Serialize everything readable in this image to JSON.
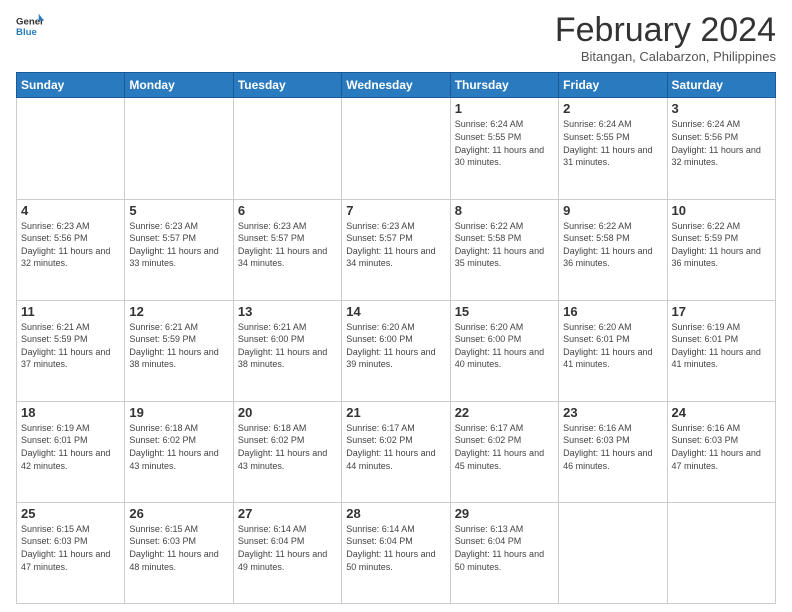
{
  "header": {
    "logo": {
      "general": "General",
      "blue": "Blue"
    },
    "title": "February 2024",
    "location": "Bitangan, Calabarzon, Philippines"
  },
  "weekdays": [
    "Sunday",
    "Monday",
    "Tuesday",
    "Wednesday",
    "Thursday",
    "Friday",
    "Saturday"
  ],
  "weeks": [
    [
      {
        "day": "",
        "info": ""
      },
      {
        "day": "",
        "info": ""
      },
      {
        "day": "",
        "info": ""
      },
      {
        "day": "",
        "info": ""
      },
      {
        "day": "1",
        "info": "Sunrise: 6:24 AM\nSunset: 5:55 PM\nDaylight: 11 hours and 30 minutes."
      },
      {
        "day": "2",
        "info": "Sunrise: 6:24 AM\nSunset: 5:55 PM\nDaylight: 11 hours and 31 minutes."
      },
      {
        "day": "3",
        "info": "Sunrise: 6:24 AM\nSunset: 5:56 PM\nDaylight: 11 hours and 32 minutes."
      }
    ],
    [
      {
        "day": "4",
        "info": "Sunrise: 6:23 AM\nSunset: 5:56 PM\nDaylight: 11 hours and 32 minutes."
      },
      {
        "day": "5",
        "info": "Sunrise: 6:23 AM\nSunset: 5:57 PM\nDaylight: 11 hours and 33 minutes."
      },
      {
        "day": "6",
        "info": "Sunrise: 6:23 AM\nSunset: 5:57 PM\nDaylight: 11 hours and 34 minutes."
      },
      {
        "day": "7",
        "info": "Sunrise: 6:23 AM\nSunset: 5:57 PM\nDaylight: 11 hours and 34 minutes."
      },
      {
        "day": "8",
        "info": "Sunrise: 6:22 AM\nSunset: 5:58 PM\nDaylight: 11 hours and 35 minutes."
      },
      {
        "day": "9",
        "info": "Sunrise: 6:22 AM\nSunset: 5:58 PM\nDaylight: 11 hours and 36 minutes."
      },
      {
        "day": "10",
        "info": "Sunrise: 6:22 AM\nSunset: 5:59 PM\nDaylight: 11 hours and 36 minutes."
      }
    ],
    [
      {
        "day": "11",
        "info": "Sunrise: 6:21 AM\nSunset: 5:59 PM\nDaylight: 11 hours and 37 minutes."
      },
      {
        "day": "12",
        "info": "Sunrise: 6:21 AM\nSunset: 5:59 PM\nDaylight: 11 hours and 38 minutes."
      },
      {
        "day": "13",
        "info": "Sunrise: 6:21 AM\nSunset: 6:00 PM\nDaylight: 11 hours and 38 minutes."
      },
      {
        "day": "14",
        "info": "Sunrise: 6:20 AM\nSunset: 6:00 PM\nDaylight: 11 hours and 39 minutes."
      },
      {
        "day": "15",
        "info": "Sunrise: 6:20 AM\nSunset: 6:00 PM\nDaylight: 11 hours and 40 minutes."
      },
      {
        "day": "16",
        "info": "Sunrise: 6:20 AM\nSunset: 6:01 PM\nDaylight: 11 hours and 41 minutes."
      },
      {
        "day": "17",
        "info": "Sunrise: 6:19 AM\nSunset: 6:01 PM\nDaylight: 11 hours and 41 minutes."
      }
    ],
    [
      {
        "day": "18",
        "info": "Sunrise: 6:19 AM\nSunset: 6:01 PM\nDaylight: 11 hours and 42 minutes."
      },
      {
        "day": "19",
        "info": "Sunrise: 6:18 AM\nSunset: 6:02 PM\nDaylight: 11 hours and 43 minutes."
      },
      {
        "day": "20",
        "info": "Sunrise: 6:18 AM\nSunset: 6:02 PM\nDaylight: 11 hours and 43 minutes."
      },
      {
        "day": "21",
        "info": "Sunrise: 6:17 AM\nSunset: 6:02 PM\nDaylight: 11 hours and 44 minutes."
      },
      {
        "day": "22",
        "info": "Sunrise: 6:17 AM\nSunset: 6:02 PM\nDaylight: 11 hours and 45 minutes."
      },
      {
        "day": "23",
        "info": "Sunrise: 6:16 AM\nSunset: 6:03 PM\nDaylight: 11 hours and 46 minutes."
      },
      {
        "day": "24",
        "info": "Sunrise: 6:16 AM\nSunset: 6:03 PM\nDaylight: 11 hours and 47 minutes."
      }
    ],
    [
      {
        "day": "25",
        "info": "Sunrise: 6:15 AM\nSunset: 6:03 PM\nDaylight: 11 hours and 47 minutes."
      },
      {
        "day": "26",
        "info": "Sunrise: 6:15 AM\nSunset: 6:03 PM\nDaylight: 11 hours and 48 minutes."
      },
      {
        "day": "27",
        "info": "Sunrise: 6:14 AM\nSunset: 6:04 PM\nDaylight: 11 hours and 49 minutes."
      },
      {
        "day": "28",
        "info": "Sunrise: 6:14 AM\nSunset: 6:04 PM\nDaylight: 11 hours and 50 minutes."
      },
      {
        "day": "29",
        "info": "Sunrise: 6:13 AM\nSunset: 6:04 PM\nDaylight: 11 hours and 50 minutes."
      },
      {
        "day": "",
        "info": ""
      },
      {
        "day": "",
        "info": ""
      }
    ]
  ]
}
